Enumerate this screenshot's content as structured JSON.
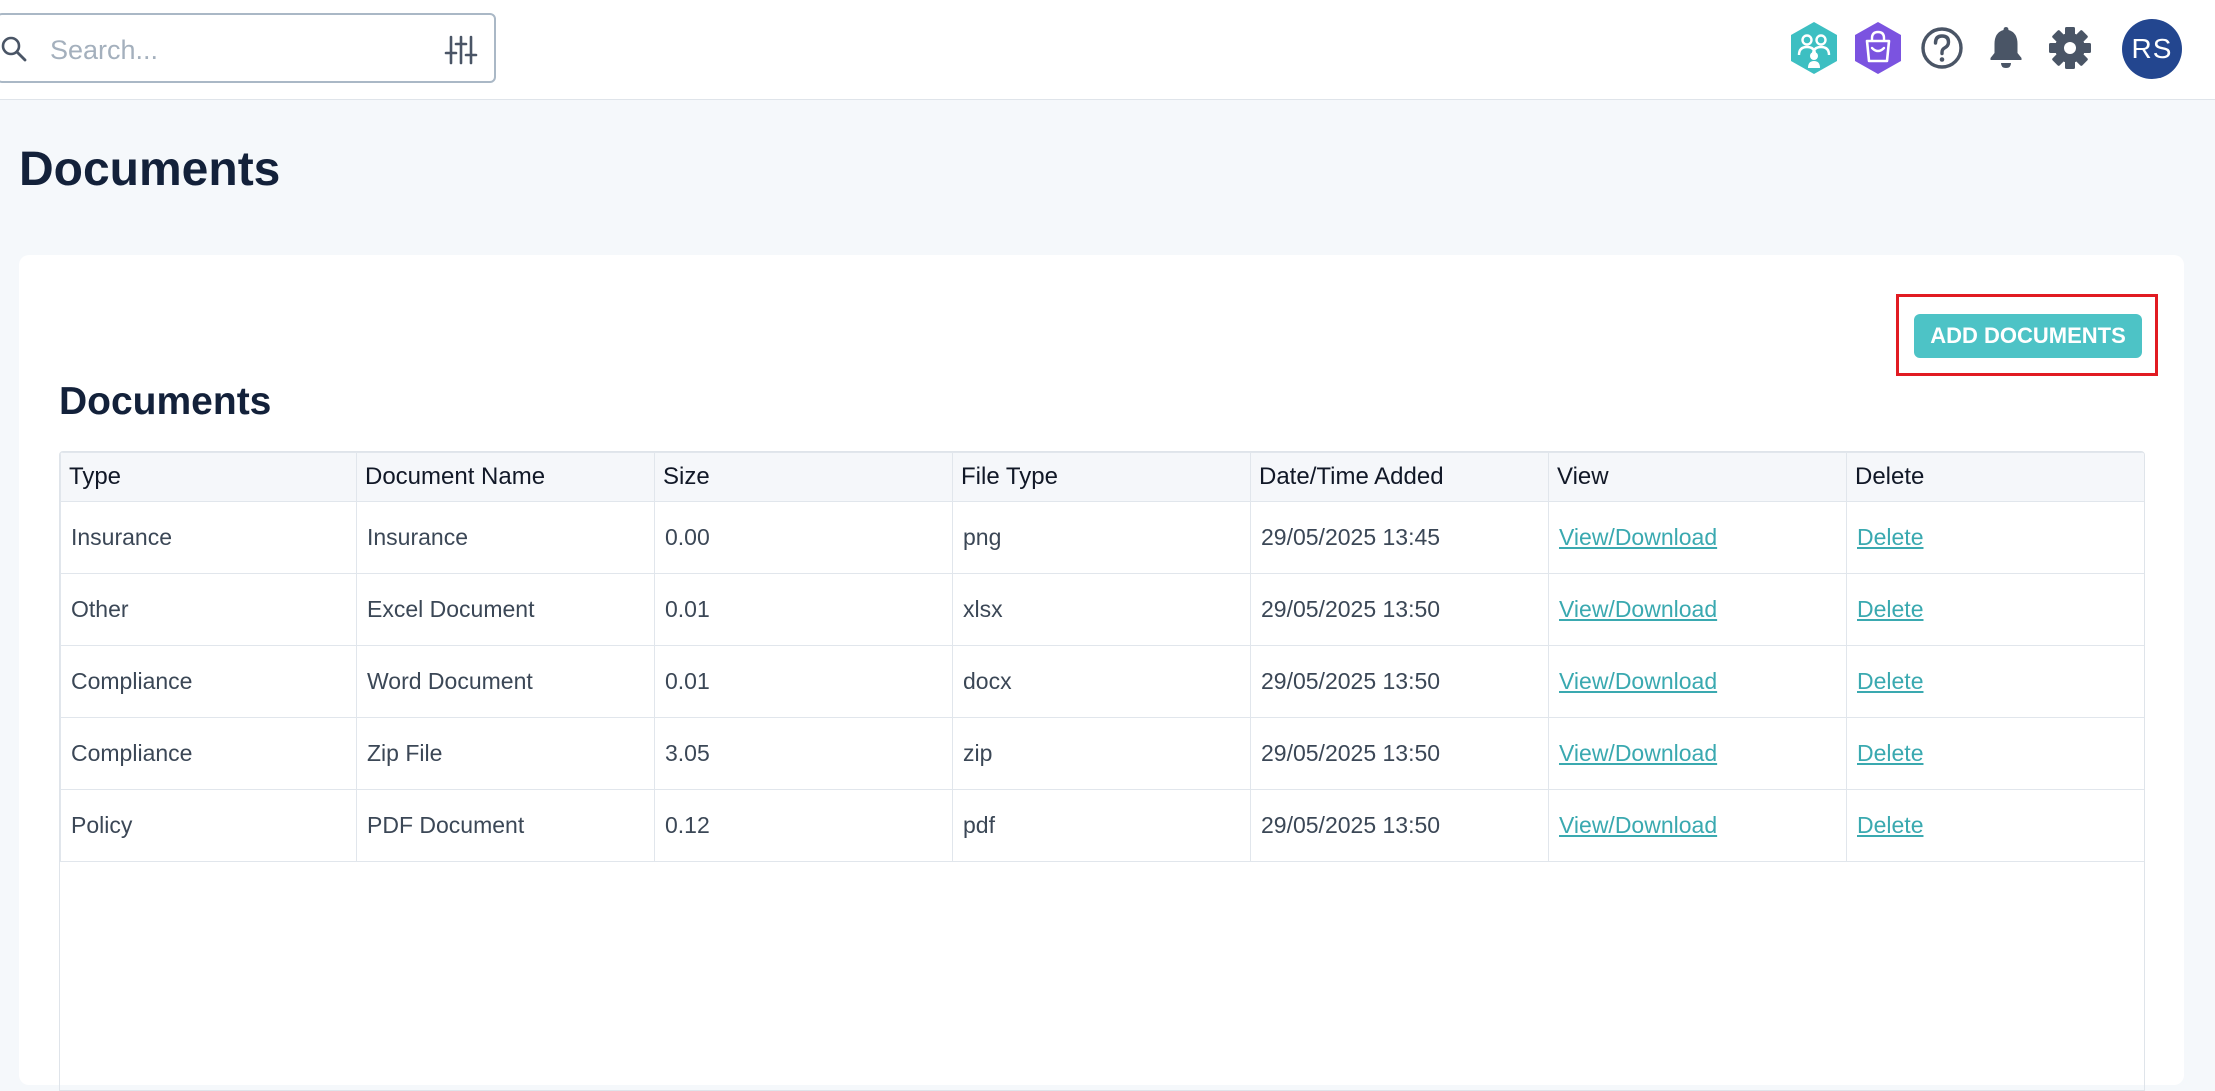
{
  "search": {
    "placeholder": "Search..."
  },
  "header": {
    "icons": [
      "people-hex-icon",
      "shopping-bag-hex-icon",
      "help-icon",
      "bell-icon",
      "gear-icon"
    ],
    "avatar_initials": "RS"
  },
  "colors": {
    "accent": "#4dc3c6",
    "link": "#3aa9b0",
    "avatar_bg": "#23468f",
    "highlight": "#e11b22"
  },
  "page": {
    "title": "Documents",
    "add_button": "ADD DOCUMENTS",
    "section_title": "Documents"
  },
  "table": {
    "columns": [
      "Type",
      "Document Name",
      "Size",
      "File Type",
      "Date/Time Added",
      "View",
      "Delete"
    ],
    "rows": [
      {
        "type": "Insurance",
        "name": "Insurance",
        "size": "0.00",
        "file_type": "png",
        "added": "29/05/2025 13:45",
        "view": "View/Download",
        "delete": "Delete"
      },
      {
        "type": "Other",
        "name": "Excel Document",
        "size": "0.01",
        "file_type": "xlsx",
        "added": "29/05/2025 13:50",
        "view": "View/Download",
        "delete": "Delete"
      },
      {
        "type": "Compliance",
        "name": "Word Document",
        "size": "0.01",
        "file_type": "docx",
        "added": "29/05/2025 13:50",
        "view": "View/Download",
        "delete": "Delete"
      },
      {
        "type": "Compliance",
        "name": "Zip File",
        "size": "3.05",
        "file_type": "zip",
        "added": "29/05/2025 13:50",
        "view": "View/Download",
        "delete": "Delete"
      },
      {
        "type": "Policy",
        "name": "PDF Document",
        "size": "0.12",
        "file_type": "pdf",
        "added": "29/05/2025 13:50",
        "view": "View/Download",
        "delete": "Delete"
      }
    ]
  }
}
